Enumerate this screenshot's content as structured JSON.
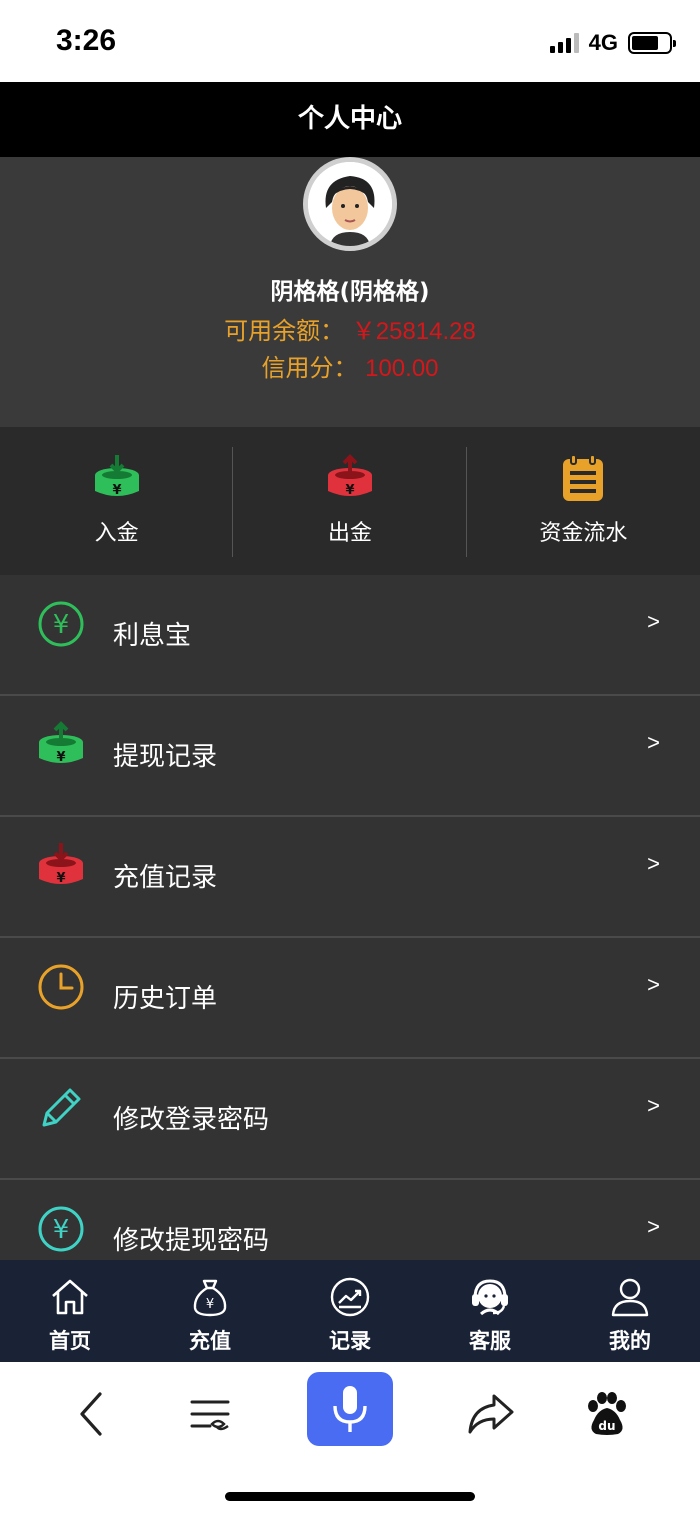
{
  "status_bar": {
    "time": "3:26",
    "network": "4G"
  },
  "header": {
    "title": "个人中心"
  },
  "profile": {
    "name": "阴格格(阴格格)",
    "balance_label": "可用余额：",
    "balance_value": "￥25814.28",
    "credit_label": "信用分：",
    "credit_value": "100.00"
  },
  "quick_actions": [
    {
      "label": "入金",
      "icon": "deposit-icon",
      "color": "#2fbf5a"
    },
    {
      "label": "出金",
      "icon": "withdraw-icon",
      "color": "#e0323c"
    },
    {
      "label": "资金流水",
      "icon": "ledger-icon",
      "color": "#e8a22a"
    }
  ],
  "menu": [
    {
      "label": "利息宝",
      "icon": "yuan-circle-icon",
      "color": "#2fbf5a",
      "arrow": ">"
    },
    {
      "label": "提现记录",
      "icon": "withdraw-record-icon",
      "color": "#2fbf5a",
      "arrow": ">"
    },
    {
      "label": "充值记录",
      "icon": "recharge-record-icon",
      "color": "#e0323c",
      "arrow": ">"
    },
    {
      "label": "历史订单",
      "icon": "clock-icon",
      "color": "#e8a22a",
      "arrow": ">"
    },
    {
      "label": "修改登录密码",
      "icon": "pencil-icon",
      "color": "#3fd3c6",
      "arrow": ">"
    },
    {
      "label": "修改提现密码",
      "icon": "yuan-circle-icon",
      "color": "#3fd3c6",
      "arrow": ">"
    }
  ],
  "bottom_nav": [
    {
      "label": "首页",
      "icon": "home-icon"
    },
    {
      "label": "充值",
      "icon": "money-bag-icon"
    },
    {
      "label": "记录",
      "icon": "chart-icon"
    },
    {
      "label": "客服",
      "icon": "headset-icon"
    },
    {
      "label": "我的",
      "icon": "user-icon"
    }
  ],
  "browser_toolbar": [
    "back-icon",
    "menu-icon",
    "microphone-icon",
    "share-icon",
    "baidu-paw-icon"
  ],
  "colors": {
    "accent_orange": "#e8a22a",
    "value_red": "#d4171b",
    "mic_blue": "#4a6cf2"
  }
}
